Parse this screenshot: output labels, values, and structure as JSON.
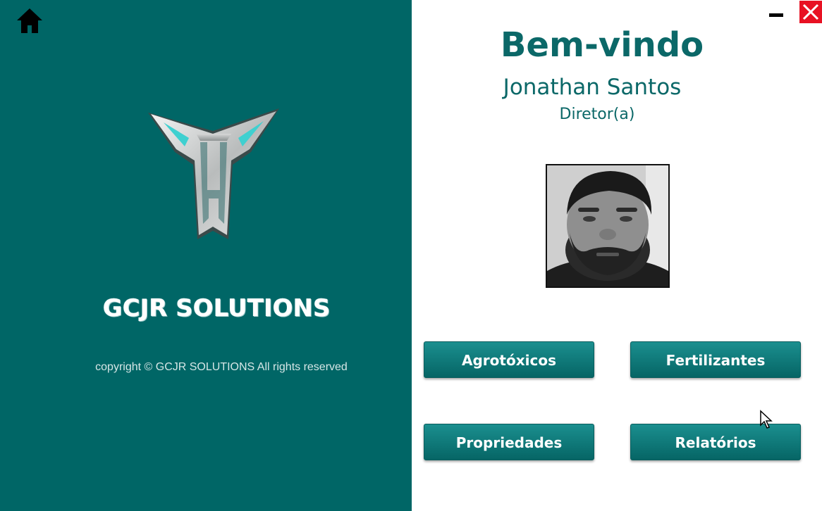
{
  "brand": {
    "name": "GCJR SOLUTIONS",
    "copyright": "copyright © GCJR SOLUTIONS All rights reserved",
    "panel_color": "#006666"
  },
  "icons": {
    "home": "home-icon",
    "logo": "gcjr-logo",
    "minimize": "minimize-icon",
    "close": "close-icon",
    "cursor": "mouse-pointer"
  },
  "welcome": {
    "title": "Bem-vindo",
    "user_name": "Jonathan Santos",
    "user_role": "Diretor(a)"
  },
  "buttons": {
    "agrotoxicos": "Agrotóxicos",
    "fertilizantes": "Fertilizantes",
    "propriedades": "Propriedades",
    "relatorios": "Relatórios"
  },
  "colors": {
    "accent": "#0b6868",
    "button": "#0f7878",
    "close": "#e81123"
  }
}
